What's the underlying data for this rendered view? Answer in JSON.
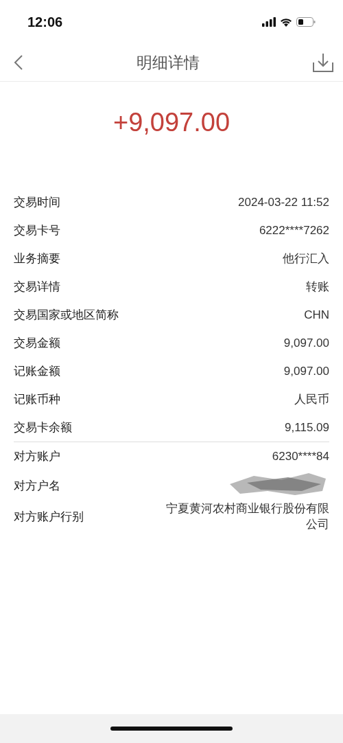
{
  "status_bar": {
    "time": "12:06"
  },
  "nav": {
    "title": "明细详情"
  },
  "amount": "+9,097.00",
  "details": [
    {
      "label": "交易时间",
      "value": "2024-03-22 11:52"
    },
    {
      "label": "交易卡号",
      "value": "6222****7262"
    },
    {
      "label": "业务摘要",
      "value": "他行汇入"
    },
    {
      "label": "交易详情",
      "value": "转账"
    },
    {
      "label": "交易国家或地区简称",
      "value": "CHN"
    },
    {
      "label": "交易金额",
      "value": "9,097.00"
    },
    {
      "label": "记账金额",
      "value": "9,097.00"
    },
    {
      "label": "记账币种",
      "value": "人民币"
    },
    {
      "label": "交易卡余额",
      "value": "9,115.09"
    }
  ],
  "counterparty": [
    {
      "label": "对方账户",
      "value": "6230****84"
    },
    {
      "label": "对方户名",
      "redacted": true
    },
    {
      "label": "对方账户行别",
      "value": "宁夏黄河农村商业银行股份有限公司"
    }
  ]
}
